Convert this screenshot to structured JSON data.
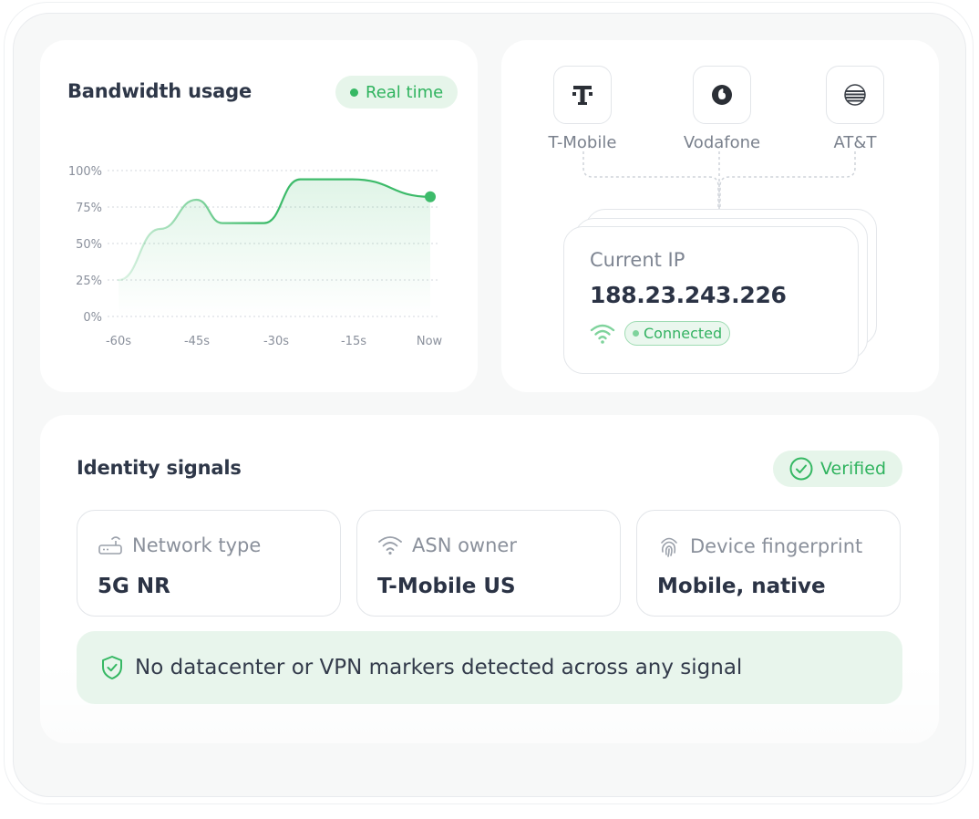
{
  "bandwidth": {
    "title": "Bandwidth usage",
    "badge": "Real time",
    "chart_data": {
      "type": "area",
      "x": [
        "-60s",
        "-52s",
        "-45s",
        "-40s",
        "-32s",
        "-25s",
        "-15s",
        "Now"
      ],
      "values": [
        25,
        60,
        80,
        64,
        64,
        94,
        94,
        82
      ],
      "ylim": [
        0,
        100
      ],
      "y_ticks": [
        "100%",
        "75%",
        "50%",
        "25%",
        "0%"
      ],
      "x_ticks": [
        "-60s",
        "-45s",
        "-30s",
        "-15s",
        "Now"
      ],
      "grid": "dotted horizontal",
      "color": "#3dbb6a"
    }
  },
  "network": {
    "carriers": [
      {
        "name": "T-Mobile",
        "icon": "t-mobile-logo-icon"
      },
      {
        "name": "Vodafone",
        "icon": "vodafone-logo-icon"
      },
      {
        "name": "AT&T",
        "icon": "att-logo-icon"
      }
    ],
    "ip_label": "Current IP",
    "ip_value": "188.23.243.226",
    "status": "Connected"
  },
  "identity": {
    "title": "Identity signals",
    "badge": "Verified",
    "signals": [
      {
        "label": "Network type",
        "value": "5G NR",
        "icon": "router-icon"
      },
      {
        "label": "ASN owner",
        "value": "T-Mobile US",
        "icon": "wifi-icon"
      },
      {
        "label": "Device fingerprint",
        "value": "Mobile, native",
        "icon": "fingerprint-icon"
      }
    ],
    "notice": "No datacenter or VPN markers detected across any signal"
  },
  "colors": {
    "accent": "#36b864",
    "text": "#2b3345",
    "muted": "#8a909b"
  }
}
